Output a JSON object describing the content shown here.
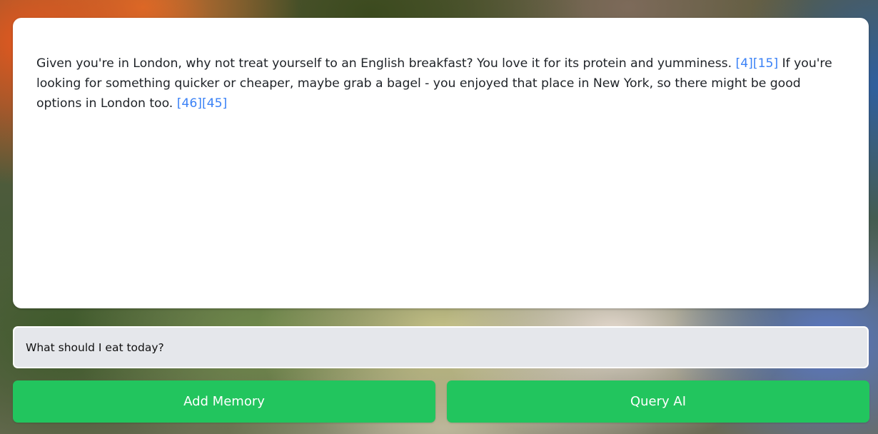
{
  "response": {
    "segments": [
      {
        "type": "text",
        "value": "Given you're in London, why not treat yourself to an English breakfast? You love it for its protein and yumminess. "
      },
      {
        "type": "citation",
        "value": "[4]"
      },
      {
        "type": "citation",
        "value": "[15]"
      },
      {
        "type": "text",
        "value": " If you're looking for something quicker or cheaper, maybe grab a bagel - you enjoyed that place in New York, so there might be good options in London too. "
      },
      {
        "type": "citation",
        "value": "[46]"
      },
      {
        "type": "citation",
        "value": "[45]"
      }
    ]
  },
  "query": {
    "value": "What should I eat today?"
  },
  "buttons": {
    "add_memory_label": "Add Memory",
    "query_ai_label": "Query AI"
  },
  "colors": {
    "accent_green": "#22c55e",
    "citation_blue": "#3b82f6",
    "input_bg": "#e5e7eb"
  }
}
